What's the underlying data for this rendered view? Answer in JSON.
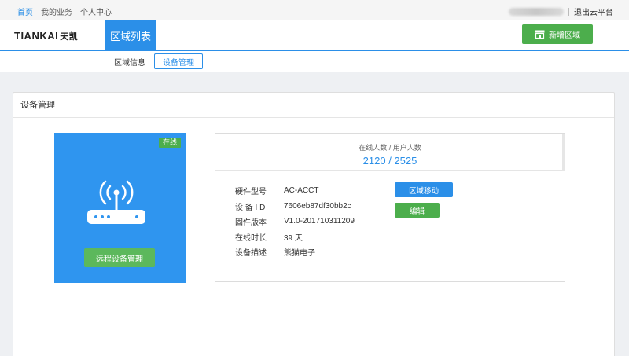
{
  "topbar": {
    "nav": [
      "首页",
      "我的业务",
      "个人中心"
    ],
    "logout": "退出云平台"
  },
  "header": {
    "logo": "TIANKAI",
    "logo_cn": "天凯",
    "region_tab": "区域列表",
    "add_button": "新增区域"
  },
  "subnav": {
    "tabs": [
      "区域信息",
      "设备管理"
    ]
  },
  "panel": {
    "title": "设备管理",
    "device": {
      "status": "在线",
      "remote_button": "远程设备管理"
    },
    "stats": {
      "label": "在线人数 / 用户人数",
      "value": "2120 / 2525"
    },
    "info": [
      {
        "key": "硬件型号",
        "value": "AC-ACCT"
      },
      {
        "key": "设 备 I D",
        "value": "7606eb87df30bb2c"
      },
      {
        "key": "固件版本",
        "value": "V1.0-201710311209"
      },
      {
        "key": "在线时长",
        "value": "39 天"
      },
      {
        "key": "设备描述",
        "value": "熊猫电子"
      }
    ],
    "buttons": {
      "move": "区域移动",
      "edit": "编辑"
    }
  },
  "colors": {
    "primary": "#2b8fe8",
    "success": "#4cae4c",
    "device_bg": "#2f95ef"
  }
}
